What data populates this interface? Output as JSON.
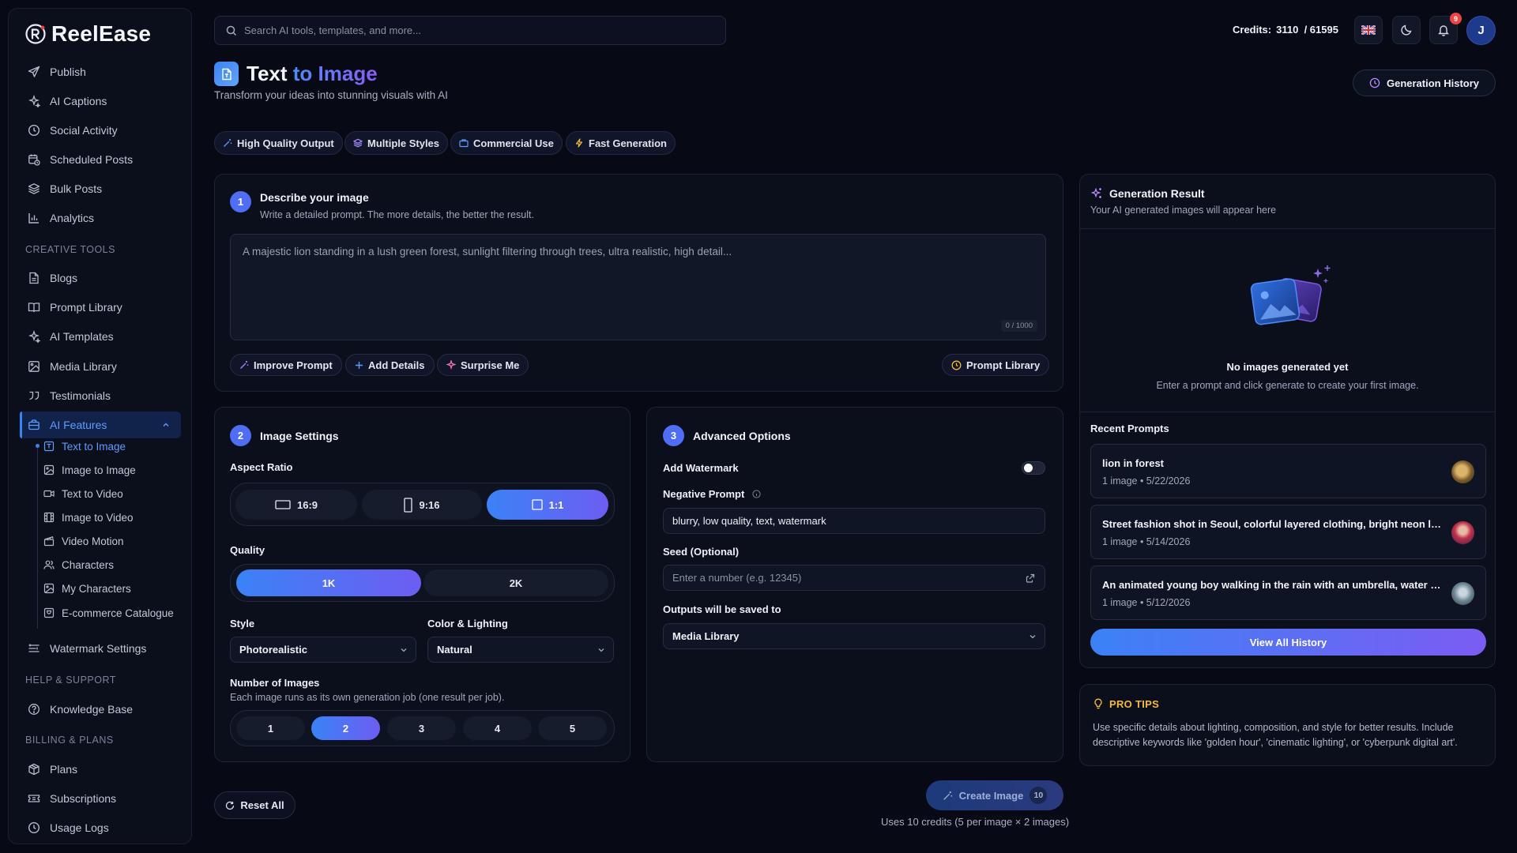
{
  "app": {
    "name": "ReelEase"
  },
  "sidebar": {
    "items": [
      {
        "label": "Publish",
        "icon": "send-icon"
      },
      {
        "label": "AI Captions",
        "icon": "sparkles-icon"
      },
      {
        "label": "Social Activity",
        "icon": "clock-icon"
      },
      {
        "label": "Scheduled Posts",
        "icon": "calendar-clock-icon"
      },
      {
        "label": "Bulk Posts",
        "icon": "layers-icon"
      },
      {
        "label": "Analytics",
        "icon": "bar-chart-icon"
      }
    ],
    "creative_heading": "CREATIVE TOOLS",
    "creative": [
      {
        "label": "Blogs",
        "icon": "file-icon"
      },
      {
        "label": "Prompt Library",
        "icon": "book-icon"
      },
      {
        "label": "AI Templates",
        "icon": "sparkles-icon"
      },
      {
        "label": "Media Library",
        "icon": "image-icon"
      },
      {
        "label": "Testimonials",
        "icon": "quote-icon"
      }
    ],
    "ai_features": "AI Features",
    "sub": [
      {
        "label": "Text to Image",
        "icon": "text-image-icon"
      },
      {
        "label": "Image to Image",
        "icon": "image-icon"
      },
      {
        "label": "Text to Video",
        "icon": "video-icon"
      },
      {
        "label": "Image to Video",
        "icon": "film-icon"
      },
      {
        "label": "Video Motion",
        "icon": "clapperboard-icon"
      },
      {
        "label": "Characters",
        "icon": "users-icon"
      },
      {
        "label": "My Characters",
        "icon": "image-icon"
      },
      {
        "label": "E-commerce Catalogue",
        "icon": "shopping-icon"
      }
    ],
    "watermark": "Watermark Settings",
    "help_heading": "HELP & SUPPORT",
    "knowledge": "Knowledge Base",
    "billing_heading": "BILLING & PLANS",
    "billing": [
      {
        "label": "Plans",
        "icon": "package-icon"
      },
      {
        "label": "Subscriptions",
        "icon": "ticket-icon"
      },
      {
        "label": "Usage Logs",
        "icon": "clock-icon"
      }
    ]
  },
  "topbar": {
    "search_placeholder": "Search AI tools, templates, and more...",
    "credits_label": "Credits:",
    "credits_used": "3110",
    "credits_total": "/ 61595",
    "notifications": "9",
    "avatar_initial": "J"
  },
  "page": {
    "title_a": "Text",
    "title_b": "to Image",
    "subtitle": "Transform your ideas into stunning visuals with AI",
    "history_btn": "Generation History",
    "chips": [
      "High Quality Output",
      "Multiple Styles",
      "Commercial Use",
      "Fast Generation"
    ]
  },
  "describe": {
    "step": "1",
    "title": "Describe your image",
    "subtitle": "Write a detailed prompt. The more details, the better the result.",
    "placeholder": "A majestic lion standing in a lush green forest, sunlight filtering through trees, ultra realistic, high detail...",
    "counter": "0 / 1000",
    "buttons": [
      "Improve Prompt",
      "Add Details",
      "Surprise Me"
    ],
    "library_btn": "Prompt Library"
  },
  "image_settings": {
    "step": "2",
    "title": "Image Settings",
    "aspect_label": "Aspect Ratio",
    "aspects": [
      "16:9",
      "9:16",
      "1:1"
    ],
    "aspect_selected": "1:1",
    "quality_label": "Quality",
    "qualities": [
      "1K",
      "2K"
    ],
    "quality_selected": "1K",
    "style_label": "Style",
    "style_value": "Photorealistic",
    "color_label": "Color & Lighting",
    "color_value": "Natural",
    "num_label": "Number of Images",
    "num_sub": "Each image runs as its own generation job (one result per job).",
    "nums": [
      "1",
      "2",
      "3",
      "4",
      "5"
    ],
    "num_selected": "2"
  },
  "advanced": {
    "step": "3",
    "title": "Advanced Options",
    "watermark_label": "Add Watermark",
    "watermark_on": false,
    "neg_label": "Negative Prompt",
    "neg_value": "blurry, low quality, text, watermark",
    "seed_label": "Seed (Optional)",
    "seed_placeholder": "Enter a number (e.g. 12345)",
    "save_label": "Outputs will be saved to",
    "save_value": "Media Library"
  },
  "actions": {
    "reset": "Reset All",
    "create": "Create Image",
    "create_badge": "10",
    "uses": "Uses 10 credits (5 per image × 2 images)"
  },
  "result": {
    "title": "Generation Result",
    "subtitle": "Your AI generated images will appear here",
    "empty_title": "No images generated yet",
    "empty_sub": "Enter a prompt and click generate to create your first image.",
    "recent_heading": "Recent Prompts",
    "recent": [
      {
        "title": "lion in forest",
        "meta": "1 image • 5/22/2026"
      },
      {
        "title": "Street fashion shot in Seoul, colorful layered clothing, bright neon lights",
        "meta": "1 image • 5/14/2026"
      },
      {
        "title": "An animated young boy walking in the rain with an umbrella, water droplets",
        "meta": "1 image • 5/12/2026"
      }
    ],
    "view_all": "View All History"
  },
  "tips": {
    "title": "PRO TIPS",
    "body": "Use specific details about lighting, composition, and style for better results. Include descriptive keywords like 'golden hour', 'cinematic lighting', or 'cyberpunk digital art'."
  },
  "colors": {
    "accent": "#3b82f6",
    "accent2": "#7c5cf2",
    "bg": "#070a14",
    "panel": "#0b0f1c",
    "tips": "#f5b93b"
  }
}
